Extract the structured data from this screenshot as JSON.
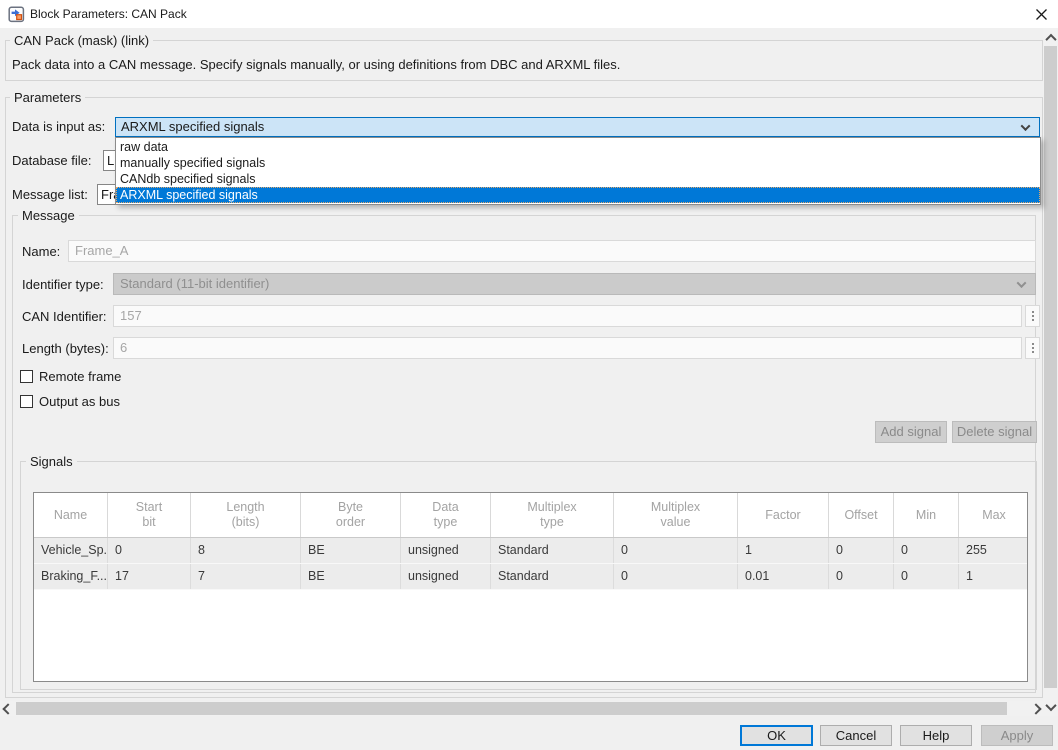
{
  "window": {
    "title": "Block Parameters: CAN Pack"
  },
  "icons": {
    "app": "simulink-block-icon",
    "close": "x-cross",
    "combobox_arrow": "chevron-down",
    "scroll_up": "chevron-up",
    "scroll_down": "chevron-down",
    "scroll_left": "chevron-left",
    "scroll_right": "chevron-right",
    "number_field_button": "vertical-dots"
  },
  "mask": {
    "title": "CAN Pack (mask) (link)",
    "description": "Pack data into a CAN message. Specify signals manually, or using definitions from DBC and ARXML files."
  },
  "parameters": {
    "group_label": "Parameters",
    "data_input": {
      "label": "Data is input as:",
      "value": "ARXML specified signals",
      "options": [
        "raw data",
        "manually specified signals",
        "CANdb specified signals",
        "ARXML specified signals"
      ],
      "selected_index": 3
    },
    "database_file": {
      "label": "Database file:",
      "value": "L:"
    },
    "message_list": {
      "label": "Message list:",
      "value": "Fra"
    }
  },
  "message": {
    "group_label": "Message",
    "name": {
      "label": "Name:",
      "value": "Frame_A"
    },
    "identifier_type": {
      "label": "Identifier type:",
      "value": "Standard (11-bit identifier)"
    },
    "can_identifier": {
      "label": "CAN Identifier:",
      "value": "157"
    },
    "length_bytes": {
      "label": "Length (bytes):",
      "value": "6"
    },
    "remote_frame": {
      "label": "Remote frame",
      "checked": false
    },
    "output_as_bus": {
      "label": "Output as bus",
      "checked": false
    },
    "add_signal_label": "Add signal",
    "delete_signal_label": "Delete signal"
  },
  "signals": {
    "group_label": "Signals",
    "columns": [
      "Name",
      "Start\nbit",
      "Length\n(bits)",
      "Byte\norder",
      "Data\ntype",
      "Multiplex\ntype",
      "Multiplex\nvalue",
      "Factor",
      "Offset",
      "Min",
      "Max"
    ],
    "rows": [
      [
        "Vehicle_Sp...",
        "0",
        "8",
        "BE",
        "unsigned",
        "Standard",
        "0",
        "1",
        "0",
        "0",
        "255"
      ],
      [
        "Braking_F...",
        "17",
        "7",
        "BE",
        "unsigned",
        "Standard",
        "0",
        "0.01",
        "0",
        "0",
        "1"
      ]
    ]
  },
  "footer": {
    "ok": "OK",
    "cancel": "Cancel",
    "help": "Help",
    "apply": "Apply"
  },
  "colors": {
    "accent": "#0078d7",
    "selection_bg": "#0078d7",
    "combobox_focus_bg": "#cce4f7",
    "dialog_bg": "#f0f0f0"
  }
}
